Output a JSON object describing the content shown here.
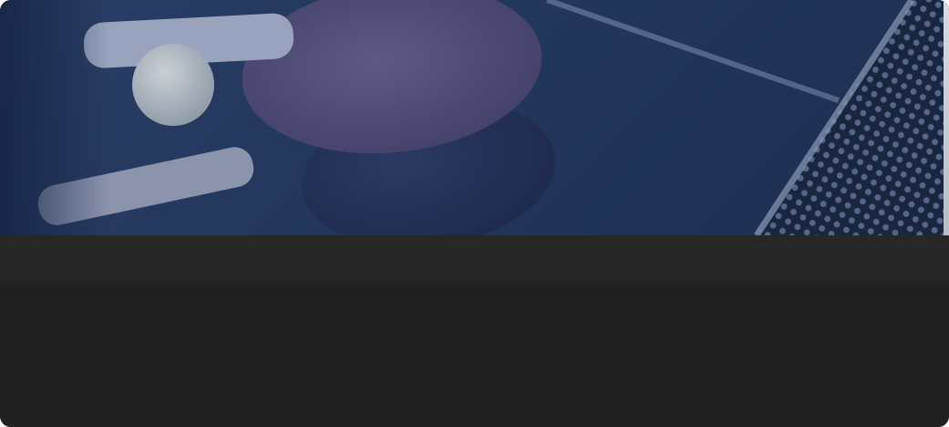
{
  "card": {
    "hero_image": "table-tennis-paddles-and-ball-on-blue-table",
    "colors": {
      "hero_tint": "#23365c",
      "header_band": "#272727",
      "body": "#202020"
    }
  }
}
